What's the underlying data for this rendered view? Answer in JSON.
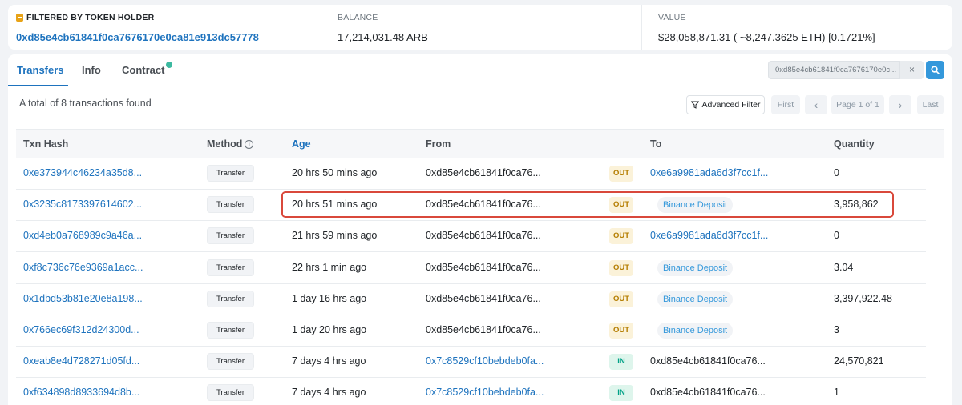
{
  "summary": {
    "filter_label": "FILTERED BY TOKEN HOLDER",
    "holder_address": "0xd85e4cb61841f0ca7676170e0ca81e913dc57778",
    "balance_label": "BALANCE",
    "balance_value": "17,214,031.48 ARB",
    "value_label": "VALUE",
    "value_value": "$28,058,871.31 ( ~8,247.3625 ETH) [0.1721%]"
  },
  "tabs": [
    {
      "label": "Transfers",
      "active": true
    },
    {
      "label": "Info",
      "active": false
    },
    {
      "label": "Contract",
      "active": false
    }
  ],
  "search": {
    "value": "0xd85e4cb61841f0ca7676170e0c...",
    "clear_icon": "×",
    "icon": "search-icon"
  },
  "toolbar": {
    "total_text": "A total of 8 transactions found",
    "advanced_filter_label": "Advanced Filter",
    "first_label": "First",
    "prev_label": "‹",
    "page_label": "Page 1 of 1",
    "next_label": "›",
    "last_label": "Last"
  },
  "table": {
    "headers": {
      "txn_hash": "Txn Hash",
      "method": "Method",
      "age": "Age",
      "from": "From",
      "to": "To",
      "quantity": "Quantity"
    },
    "rows": [
      {
        "hash": "0xe373944c46234a35d8...",
        "method": "Transfer",
        "age": "20 hrs 50 mins ago",
        "from": "0xd85e4cb61841f0ca76...",
        "dir": "OUT",
        "to": "0xe6a9981ada6d3f7cc1f...",
        "quantity": "0"
      },
      {
        "hash": "0x3235c8173397614602...",
        "method": "Transfer",
        "age": "20 hrs 51 mins ago",
        "from": "0xd85e4cb61841f0ca76...",
        "dir": "OUT",
        "to": "Binance Deposit",
        "quantity": "3,958,862"
      },
      {
        "hash": "0xd4eb0a768989c9a46a...",
        "method": "Transfer",
        "age": "21 hrs 59 mins ago",
        "from": "0xd85e4cb61841f0ca76...",
        "dir": "OUT",
        "to": "0xe6a9981ada6d3f7cc1f...",
        "quantity": "0"
      },
      {
        "hash": "0xf8c736c76e9369a1acc...",
        "method": "Transfer",
        "age": "22 hrs 1 min ago",
        "from": "0xd85e4cb61841f0ca76...",
        "dir": "OUT",
        "to": "Binance Deposit",
        "quantity": "3.04"
      },
      {
        "hash": "0x1dbd53b81e20e8a198...",
        "method": "Transfer",
        "age": "1 day 16 hrs ago",
        "from": "0xd85e4cb61841f0ca76...",
        "dir": "OUT",
        "to": "Binance Deposit",
        "quantity": "3,397,922.48"
      },
      {
        "hash": "0x766ec69f312d24300d...",
        "method": "Transfer",
        "age": "1 day 20 hrs ago",
        "from": "0xd85e4cb61841f0ca76...",
        "dir": "OUT",
        "to": "Binance Deposit",
        "quantity": "3"
      },
      {
        "hash": "0xeab8e4d728271d05fd...",
        "method": "Transfer",
        "age": "7 days 4 hrs ago",
        "from": "0x7c8529cf10bebdeb0fa...",
        "dir": "IN",
        "to": "0xd85e4cb61841f0ca76...",
        "quantity": "24,570,821"
      },
      {
        "hash": "0xf634898d8933694d8b...",
        "method": "Transfer",
        "age": "7 days 4 hrs ago",
        "from": "0x7c8529cf10bebdeb0fa...",
        "dir": "IN",
        "to": "0xd85e4cb61841f0ca76...",
        "quantity": "1"
      }
    ]
  },
  "colors": {
    "accent": "#1e73be",
    "out_badge": "#fbf2d9",
    "in_badge": "#def5ec",
    "highlight": "#d9483b"
  }
}
